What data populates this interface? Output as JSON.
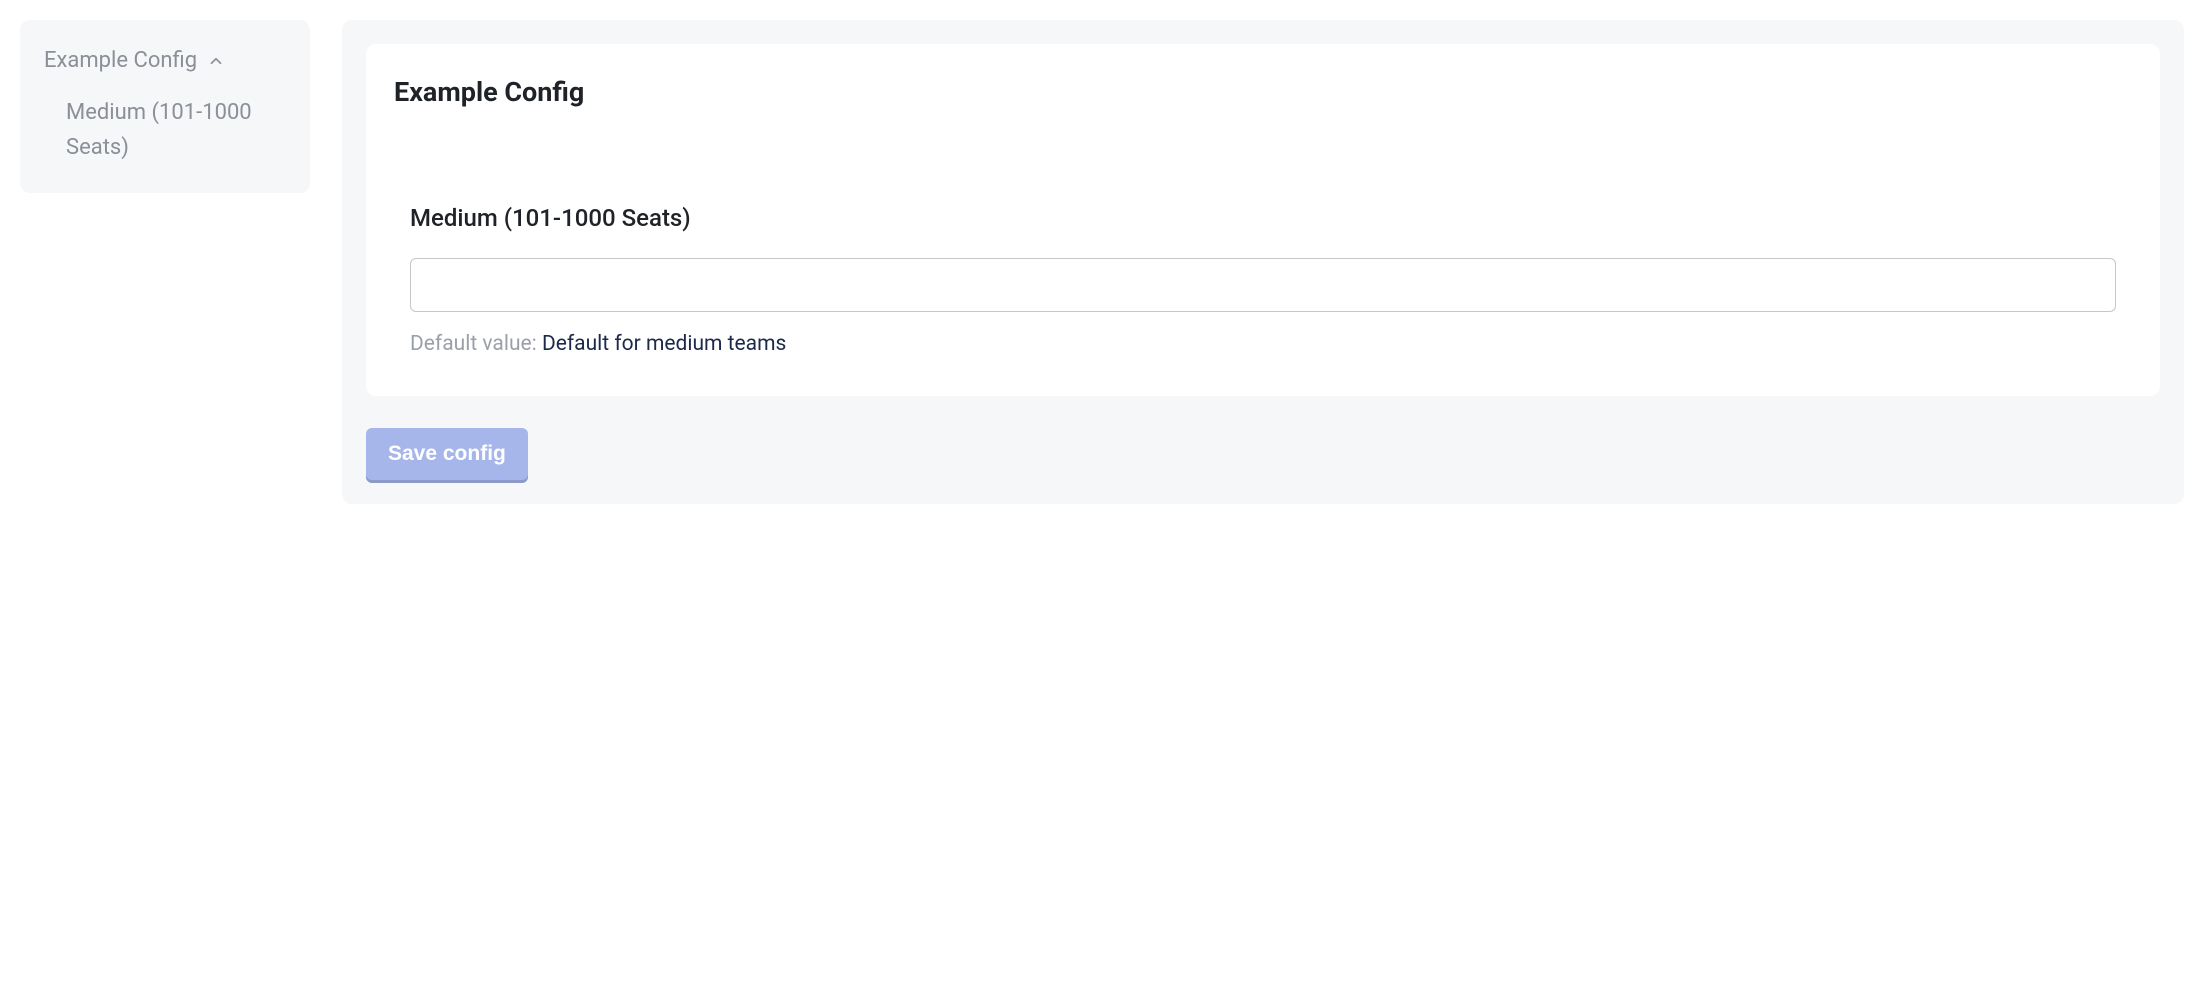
{
  "sidebar": {
    "title": "Example Config",
    "items": [
      {
        "label": "Medium (101-1000 Seats)"
      }
    ]
  },
  "main": {
    "card": {
      "title": "Example Config",
      "field": {
        "label": "Medium (101-1000 Seats)",
        "value": "",
        "default_label": "Default value: ",
        "default_value": "Default for medium teams"
      }
    },
    "save_label": "Save config"
  }
}
